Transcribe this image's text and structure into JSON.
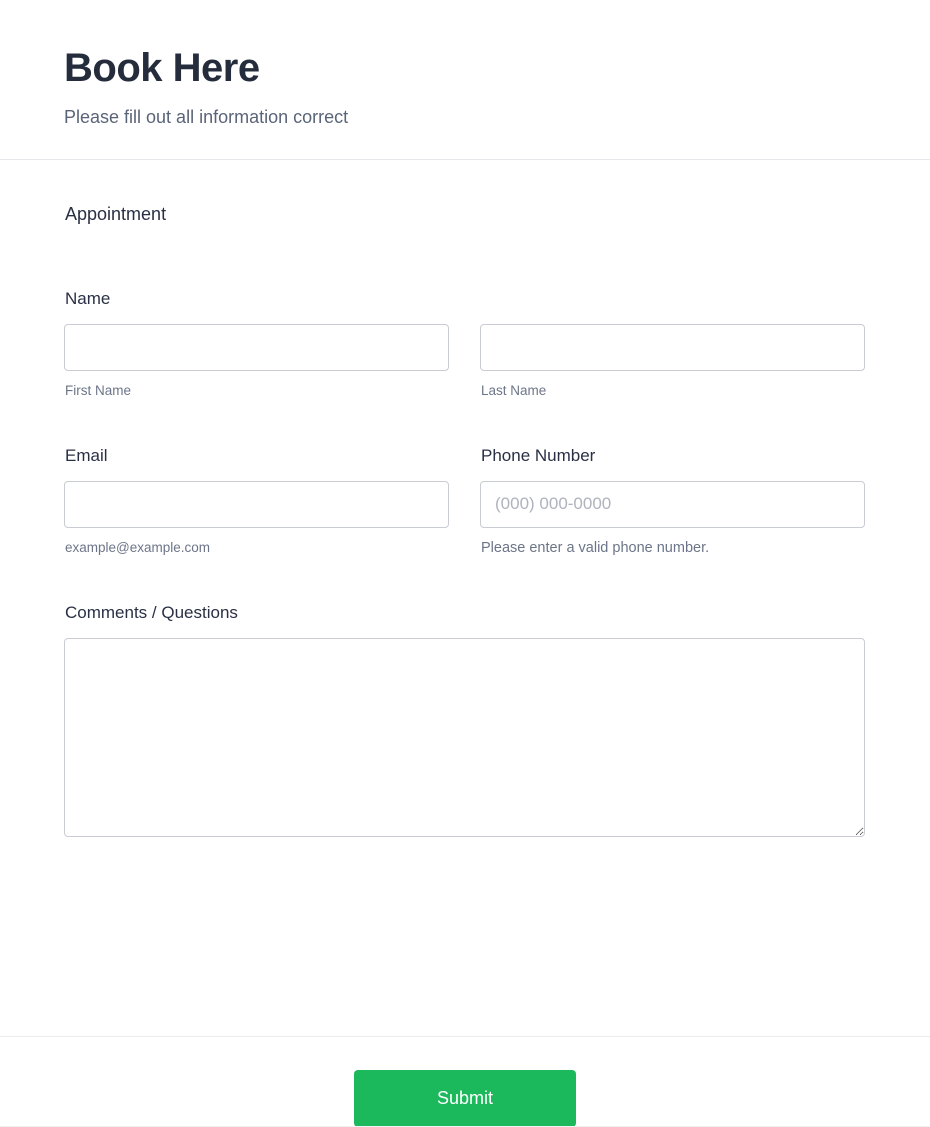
{
  "header": {
    "title": "Book Here",
    "subtitle": "Please fill out all information correct"
  },
  "form": {
    "section_heading": "Appointment",
    "fields": {
      "name": {
        "label": "Name",
        "first": {
          "value": "",
          "placeholder": "",
          "hint": "First Name"
        },
        "last": {
          "value": "",
          "placeholder": "",
          "hint": "Last Name"
        }
      },
      "email": {
        "label": "Email",
        "value": "",
        "placeholder": "",
        "hint": "example@example.com"
      },
      "phone": {
        "label": "Phone Number",
        "value": "",
        "placeholder": "(000) 000-0000",
        "hint": "Please enter a valid phone number."
      },
      "comments": {
        "label": "Comments / Questions",
        "value": "",
        "placeholder": ""
      }
    }
  },
  "footer": {
    "submit_label": "Submit"
  },
  "colors": {
    "submit_green": "#1cb85c",
    "heading_navy": "#252d3d",
    "subtitle_grey": "#5a6478",
    "hint_grey": "#6c7588",
    "border_grey": "#c9ccd2",
    "divider": "#e8e8ec",
    "placeholder_grey": "#aeb3bd"
  }
}
